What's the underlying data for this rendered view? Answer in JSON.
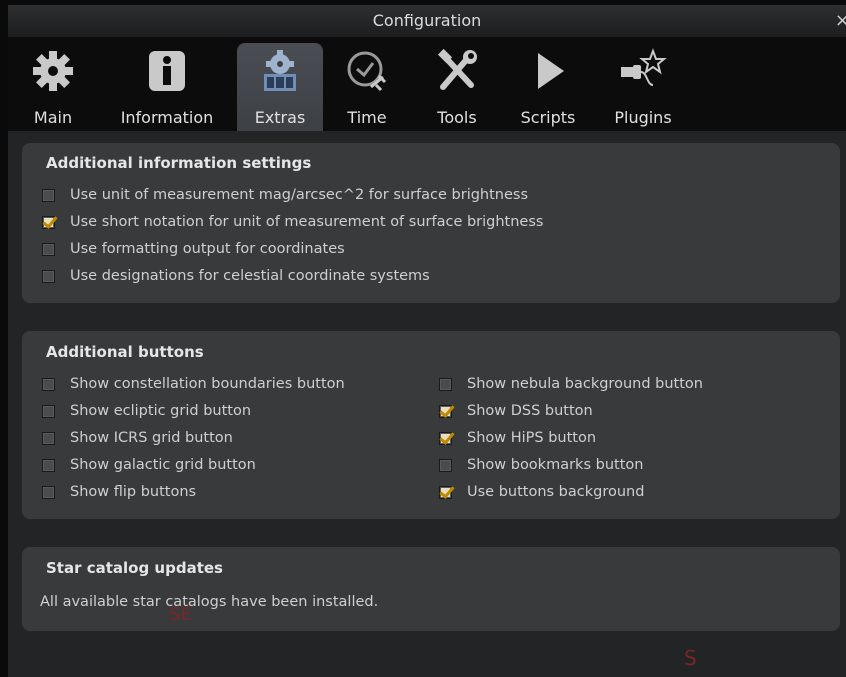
{
  "window": {
    "title": "Configuration",
    "close_glyph": "×"
  },
  "tabs": [
    {
      "label": "Main",
      "icon": "gear-icon"
    },
    {
      "label": "Information",
      "icon": "info-icon"
    },
    {
      "label": "Extras",
      "icon": "extras-icon",
      "active": true
    },
    {
      "label": "Time",
      "icon": "clock-icon"
    },
    {
      "label": "Tools",
      "icon": "tools-icon"
    },
    {
      "label": "Scripts",
      "icon": "play-icon"
    },
    {
      "label": "Plugins",
      "icon": "plugin-icon"
    }
  ],
  "additional_info": {
    "title": "Additional information settings",
    "options": [
      {
        "label": "Use unit of measurement mag/arcsec^2 for surface brightness",
        "checked": false
      },
      {
        "label": "Use short notation for unit of measurement of surface brightness",
        "checked": true
      },
      {
        "label": "Use formatting output for coordinates",
        "checked": false
      },
      {
        "label": "Use designations for celestial coordinate systems",
        "checked": false
      }
    ]
  },
  "additional_buttons": {
    "title": "Additional buttons",
    "left": [
      {
        "label": "Show constellation boundaries button",
        "checked": false
      },
      {
        "label": "Show ecliptic grid button",
        "checked": false
      },
      {
        "label": "Show ICRS grid button",
        "checked": false
      },
      {
        "label": "Show galactic grid button",
        "checked": false
      },
      {
        "label": "Show flip buttons",
        "checked": false
      }
    ],
    "right": [
      {
        "label": "Show nebula background button",
        "checked": false
      },
      {
        "label": "Show DSS button",
        "checked": true
      },
      {
        "label": "Show HiPS button",
        "checked": true
      },
      {
        "label": "Show bookmarks button",
        "checked": false
      },
      {
        "label": "Use buttons background",
        "checked": true
      }
    ]
  },
  "star_catalog": {
    "title": "Star catalog updates",
    "status": "All available star catalogs have been installed."
  },
  "background_marks": {
    "se": "SE",
    "s": "S"
  },
  "colors": {
    "accent_check": "#c08a00",
    "panel": "#393a3c",
    "tabbar": "#0c0c0d"
  }
}
